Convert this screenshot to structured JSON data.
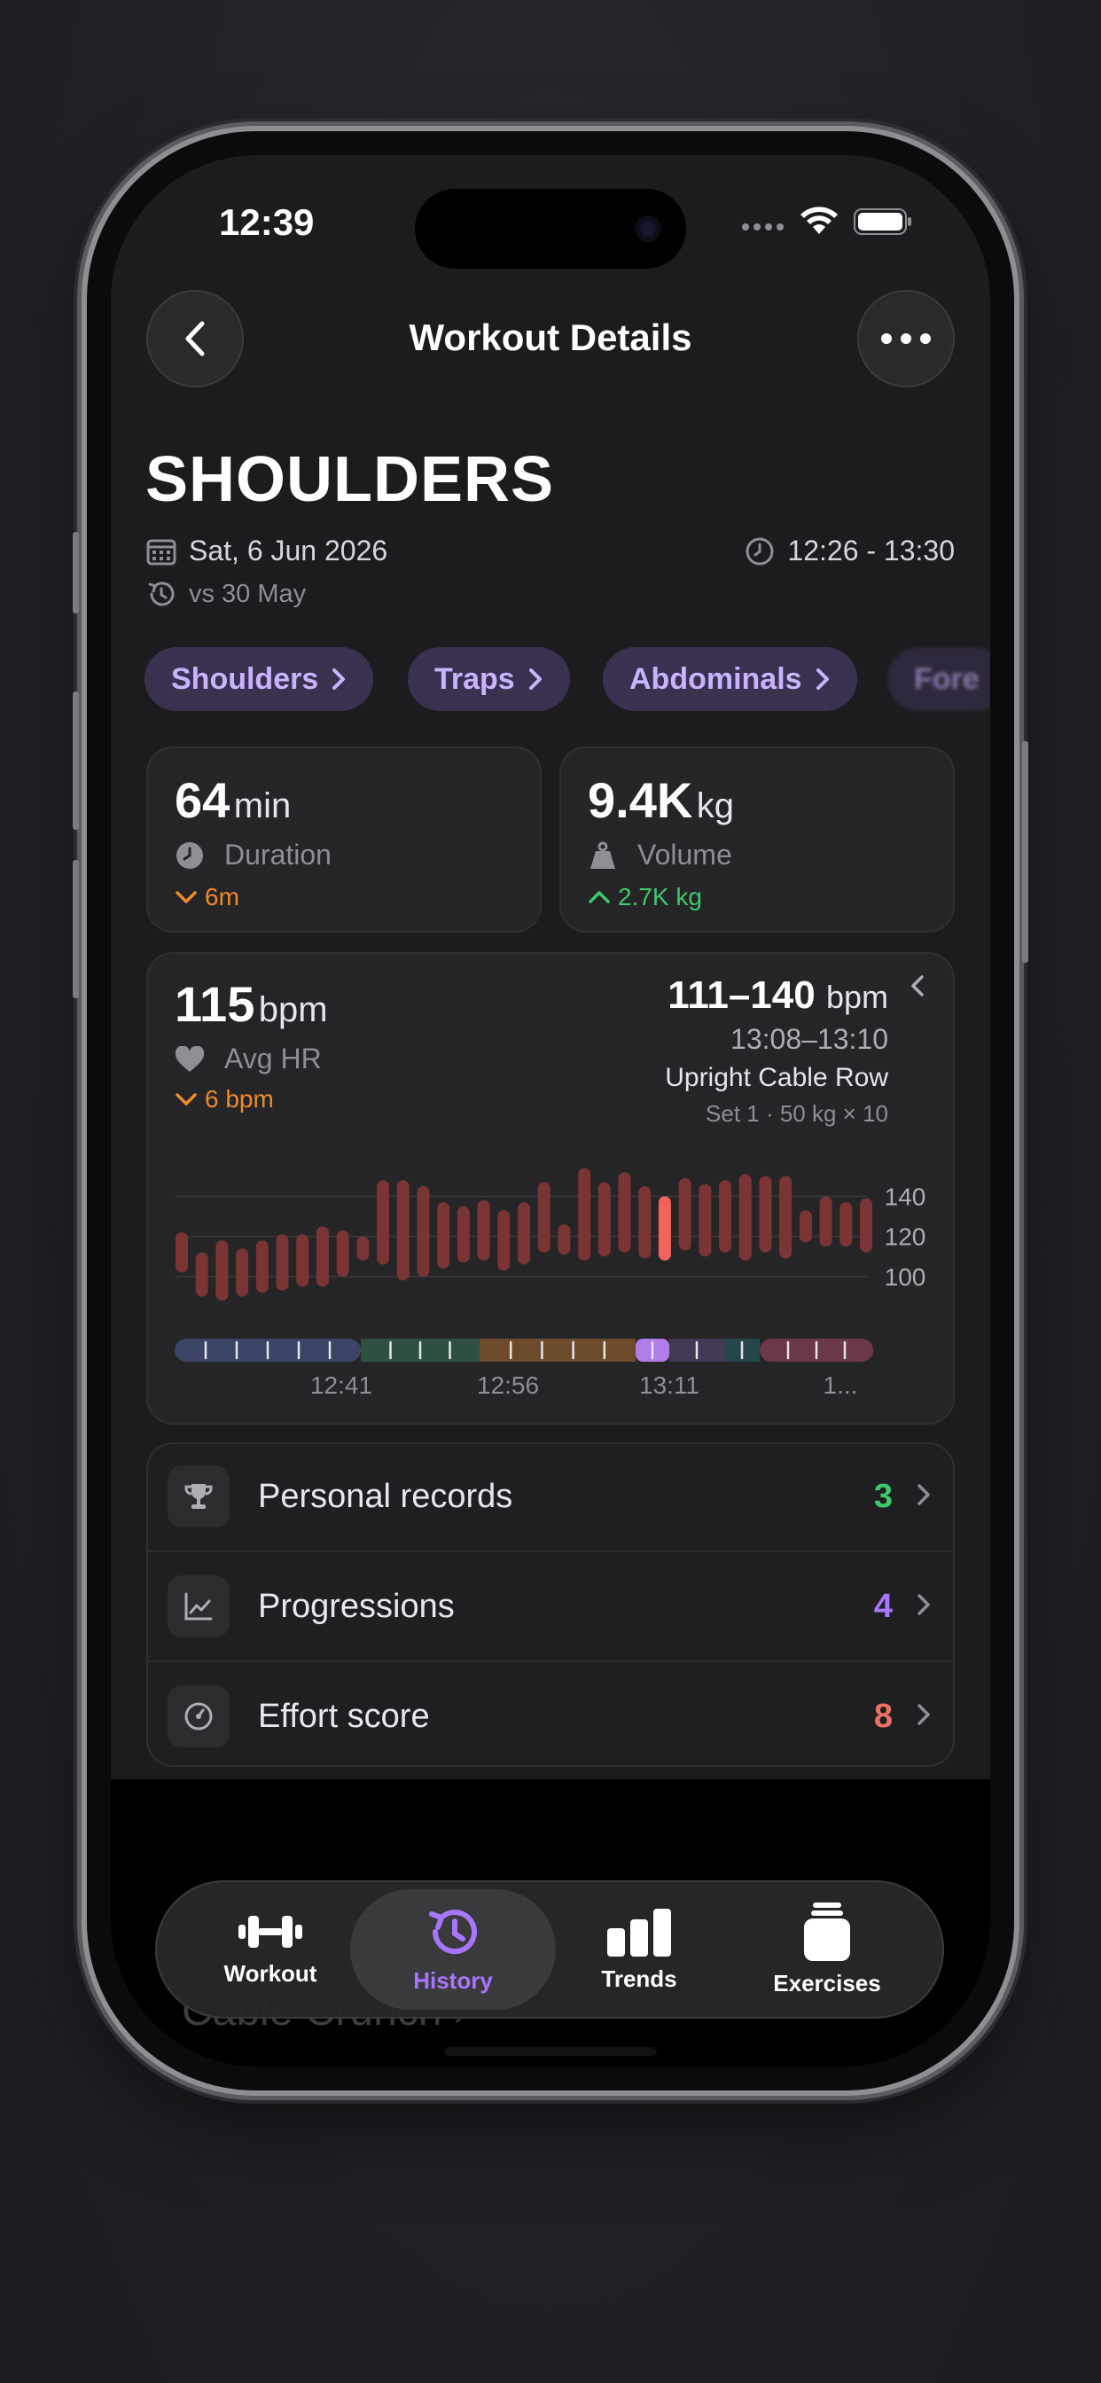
{
  "status_bar": {
    "time": "12:39"
  },
  "nav": {
    "title": "Workout Details"
  },
  "workout": {
    "title": "SHOULDERS",
    "date": "Sat, 6 Jun 2026",
    "time_range": "12:26 - 13:30",
    "compare": "vs 30 May"
  },
  "muscle_chips": [
    "Shoulders",
    "Traps",
    "Abdominals",
    "Fore"
  ],
  "stats": {
    "duration": {
      "value": "64",
      "unit": "min",
      "label": "Duration",
      "delta": "6m"
    },
    "volume": {
      "value": "9.4K",
      "unit": "kg",
      "label": "Volume",
      "delta": "2.7K kg"
    }
  },
  "heart_rate": {
    "avg_value": "115",
    "unit": "bpm",
    "label": "Avg HR",
    "delta": "6 bpm",
    "selection": {
      "range": "111–140",
      "unit": "bpm",
      "time": "13:08–13:10",
      "exercise": "Upright Cable Row",
      "set": "Set 1 · 50 kg × 10"
    },
    "y_ticks": [
      "140",
      "120",
      "100"
    ],
    "x_ticks": [
      "12:41",
      "12:56",
      "13:11",
      "1..."
    ]
  },
  "hr_chart": {
    "bars": [
      [
        102,
        122
      ],
      [
        90,
        112
      ],
      [
        88,
        118
      ],
      [
        90,
        114
      ],
      [
        92,
        118
      ],
      [
        93,
        121
      ],
      [
        95,
        121
      ],
      [
        95,
        125
      ],
      [
        100,
        123
      ],
      [
        108,
        120
      ],
      [
        106,
        148
      ],
      [
        98,
        148
      ],
      [
        100,
        145
      ],
      [
        104,
        137
      ],
      [
        107,
        135
      ],
      [
        108,
        138
      ],
      [
        103,
        133
      ],
      [
        106,
        137
      ],
      [
        112,
        147
      ],
      [
        111,
        126
      ],
      [
        108,
        154
      ],
      [
        110,
        147
      ],
      [
        112,
        152
      ],
      [
        109,
        145
      ],
      [
        108,
        140
      ],
      [
        113,
        149
      ],
      [
        110,
        146
      ],
      [
        112,
        148
      ],
      [
        108,
        151
      ],
      [
        112,
        150
      ],
      [
        109,
        150
      ],
      [
        117,
        133
      ],
      [
        115,
        140
      ],
      [
        115,
        137
      ],
      [
        112,
        139
      ]
    ],
    "selected_index": 24,
    "y_min": 85,
    "y_max": 160,
    "segment_colors": [
      "#3b4466",
      "#2e5040",
      "#6e4a2d",
      "#b07ce8",
      "#423a55",
      "#25474a",
      "#6a3848"
    ]
  },
  "summary_rows": [
    {
      "label": "Personal records",
      "count": "3",
      "color": "#3dc96b"
    },
    {
      "label": "Progressions",
      "count": "4",
      "color": "#a875ff"
    },
    {
      "label": "Effort score",
      "count": "8",
      "color": "#f07068"
    }
  ],
  "tabbar": {
    "tabs": [
      {
        "label": "Workout",
        "icon": "dumbbell-icon"
      },
      {
        "label": "History",
        "icon": "history-icon"
      },
      {
        "label": "Trends",
        "icon": "bar-chart-icon"
      },
      {
        "label": "Exercises",
        "icon": "jar-icon"
      }
    ],
    "active": "History",
    "active_color": "#a875ff"
  },
  "underlay": {
    "text": "Cable Crunch"
  }
}
